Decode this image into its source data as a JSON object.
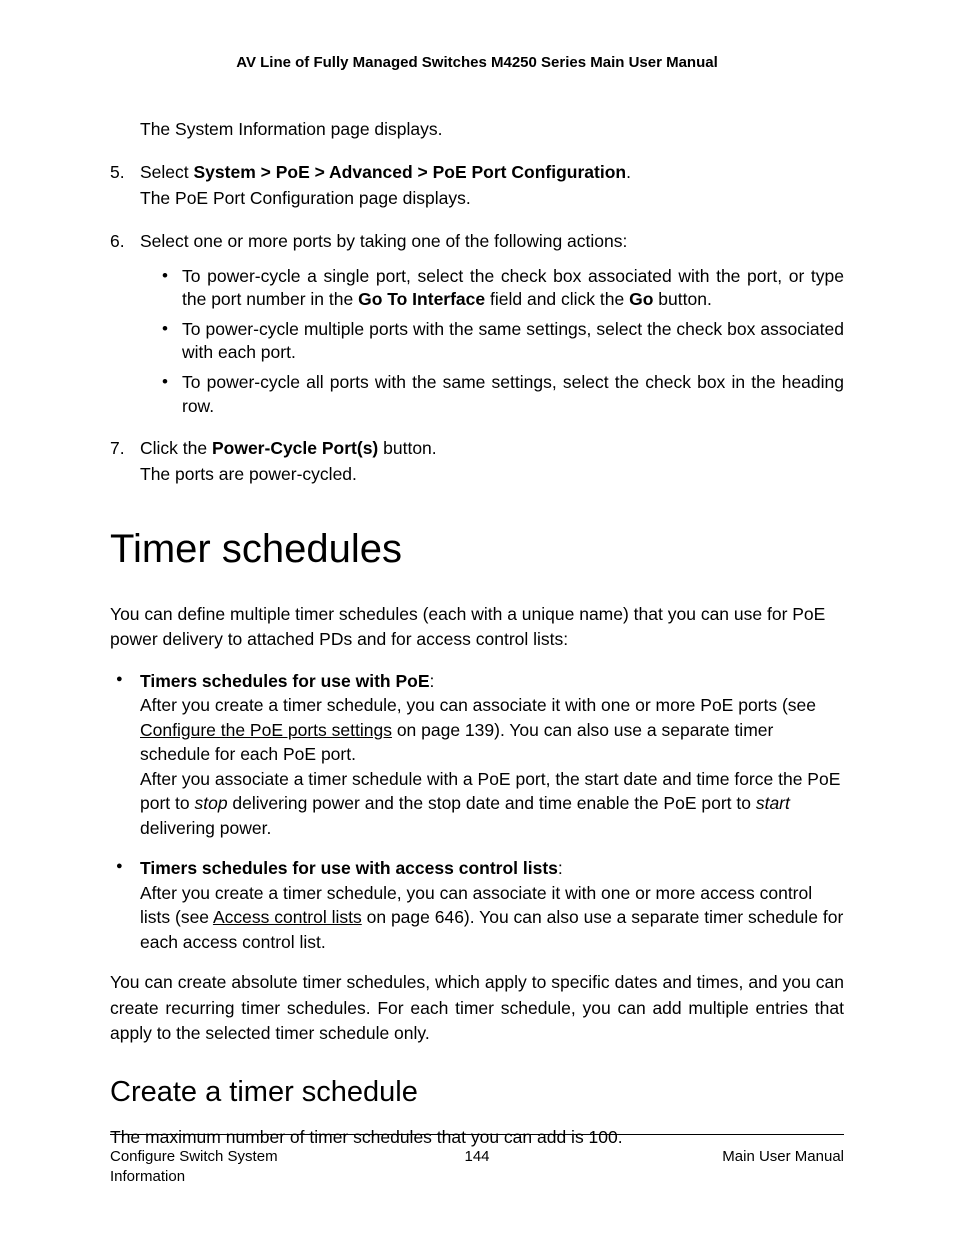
{
  "header": {
    "title": "AV Line of Fully Managed Switches M4250 Series Main User Manual"
  },
  "intro_line": "The System Information page displays.",
  "steps": [
    {
      "num": "5.",
      "pre": "Select ",
      "bold": "System > PoE > Advanced > PoE Port Configuration",
      "post": ".",
      "after": "The PoE Port Configuration page displays."
    },
    {
      "num": "6.",
      "text": "Select one or more ports by taking one of the following actions:",
      "bullets": [
        {
          "p1": "To power-cycle a single port, select the check box associated with the port, or type the port number in the ",
          "b1": "Go To Interface",
          "p2": " field and click the ",
          "b2": "Go",
          "p3": " button."
        },
        {
          "p1": "To power-cycle multiple ports with the same settings, select the check box associated with each port."
        },
        {
          "p1": "To power-cycle all ports with the same settings, select the check box in the heading row."
        }
      ]
    },
    {
      "num": "7.",
      "pre": "Click the ",
      "bold": "Power-Cycle Port(s)",
      "post": " button.",
      "after": "The ports are power-cycled."
    }
  ],
  "section": {
    "title": "Timer schedules",
    "intro": "You can define multiple timer schedules (each with a unique name) that you can use for PoE power delivery to attached PDs and for access control lists:",
    "items": [
      {
        "bold_lead": "Timers schedules for use with PoE",
        "colon": ":",
        "line1_a": "After you create a timer schedule, you can associate it with one or more PoE ports (see ",
        "link": "Configure the PoE ports settings",
        "line1_b": " on page 139). You can also use a separate timer schedule for each PoE port.",
        "line2_a": "After you associate a timer schedule with a PoE port, the start date and time force the PoE port to ",
        "ital1": "stop",
        "line2_b": " delivering power and the stop date and time enable the PoE port to ",
        "ital2": "start",
        "line2_c": " delivering power."
      },
      {
        "bold_lead": "Timers schedules for use with access control lists",
        "colon": ":",
        "line1_a": "After you create a timer schedule, you can associate it with one or more access control lists (see ",
        "link": "Access control lists",
        "line1_b": " on page 646). You can also use a separate timer schedule for each access control list."
      }
    ],
    "outro": "You can create absolute timer schedules, which apply to specific dates and times, and you can create recurring timer schedules. For each timer schedule, you can add multiple entries that apply to the selected timer schedule only."
  },
  "subsection": {
    "title": "Create a timer schedule",
    "text": "The maximum number of timer schedules that you can add is 100."
  },
  "footer": {
    "left": "Configure Switch System Information",
    "center": "144",
    "right": "Main User Manual"
  }
}
